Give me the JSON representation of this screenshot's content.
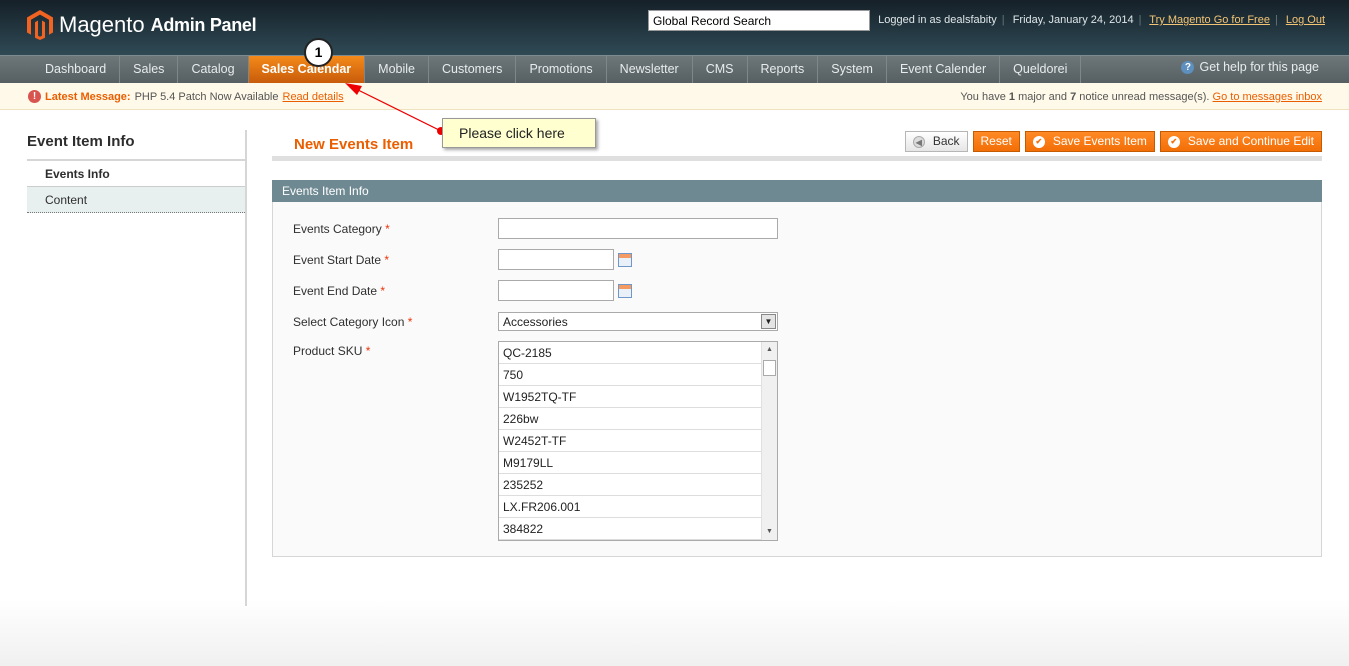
{
  "header": {
    "brand": "Magento",
    "brand_sub": "Admin Panel",
    "search_value": "Global Record Search",
    "logged_in": "Logged in as dealsfabity",
    "date": "Friday, January 24, 2014",
    "try_link": "Try Magento Go for Free",
    "logout": "Log Out"
  },
  "nav": {
    "items": [
      "Dashboard",
      "Sales",
      "Catalog",
      "Sales Calendar",
      "Mobile",
      "Customers",
      "Promotions",
      "Newsletter",
      "CMS",
      "Reports",
      "System",
      "Event Calender",
      "Queldorei"
    ],
    "active": "Sales Calendar",
    "help": "Get help for this page"
  },
  "messages": {
    "latest_label": "Latest Message:",
    "latest_text": "PHP 5.4 Patch Now Available",
    "read_details": "Read details",
    "summary_prefix": "You have",
    "major_count": "1",
    "summary_mid": "major and",
    "notice_count": "7",
    "summary_suffix": "notice unread message(s).",
    "inbox_link": "Go to messages inbox"
  },
  "sidebar": {
    "title": "Event Item Info",
    "tabs": [
      "Events Info",
      "Content"
    ]
  },
  "page": {
    "title": "New Events Item",
    "buttons": {
      "back": "Back",
      "reset": "Reset",
      "save": "Save Events Item",
      "save_continue": "Save and Continue Edit"
    }
  },
  "form": {
    "section_title": "Events Item Info",
    "required_mark": "*",
    "fields": {
      "category": "Events Category",
      "start_date": "Event Start Date",
      "end_date": "Event End Date",
      "category_icon": "Select Category Icon",
      "sku": "Product SKU"
    },
    "category_icon_value": "Accessories",
    "sku_options": [
      "QC-2185",
      "750",
      "W1952TQ-TF",
      "226bw",
      "W2452T-TF",
      "M9179LL",
      "235252",
      "LX.FR206.001",
      "384822"
    ]
  },
  "annotation": {
    "step": "1",
    "tooltip": "Please click here"
  },
  "colors": {
    "accent": "#eb5e00",
    "section_header": "#6f8992"
  }
}
